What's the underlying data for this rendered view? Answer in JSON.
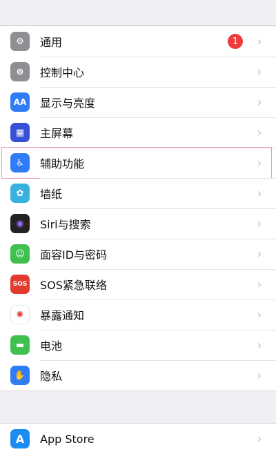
{
  "settings": {
    "items": [
      {
        "label": "通用",
        "icon": "gear-icon",
        "color": "#8e8e93",
        "glyph": "⚙",
        "badge": "1"
      },
      {
        "label": "控制中心",
        "icon": "toggles-icon",
        "color": "#8e8e93",
        "glyph": "⊜"
      },
      {
        "label": "显示与亮度",
        "icon": "aa-text-icon",
        "color": "#2f7cf6",
        "glyph": "AA"
      },
      {
        "label": "主屏幕",
        "icon": "home-grid-icon",
        "color": "#3651d6",
        "glyph": "▦"
      },
      {
        "label": "辅助功能",
        "icon": "accessibility-icon",
        "color": "#2f7cf6",
        "glyph": "♿"
      },
      {
        "label": "墙纸",
        "icon": "flower-icon",
        "color": "#38b1de",
        "glyph": "✿"
      },
      {
        "label": "Siri与搜索",
        "icon": "siri-icon",
        "color": "#222222",
        "glyph": "◉"
      },
      {
        "label": "面容ID与密码",
        "icon": "face-id-icon",
        "color": "#3fc04f",
        "glyph": "☺"
      },
      {
        "label": "SOS紧急联络",
        "icon": "sos-icon",
        "color": "#e23b2f",
        "glyph": "SOS"
      },
      {
        "label": "暴露通知",
        "icon": "exposure-icon",
        "color": "#ffffff",
        "glyph": "✺"
      },
      {
        "label": "电池",
        "icon": "battery-icon",
        "color": "#3fc04f",
        "glyph": "▬"
      },
      {
        "label": "隐私",
        "icon": "hand-icon",
        "color": "#2f7cf6",
        "glyph": "✋"
      }
    ],
    "appstore": {
      "label": "App Store",
      "icon": "app-store-icon",
      "color": "#1b8cf2",
      "glyph": "A"
    }
  }
}
